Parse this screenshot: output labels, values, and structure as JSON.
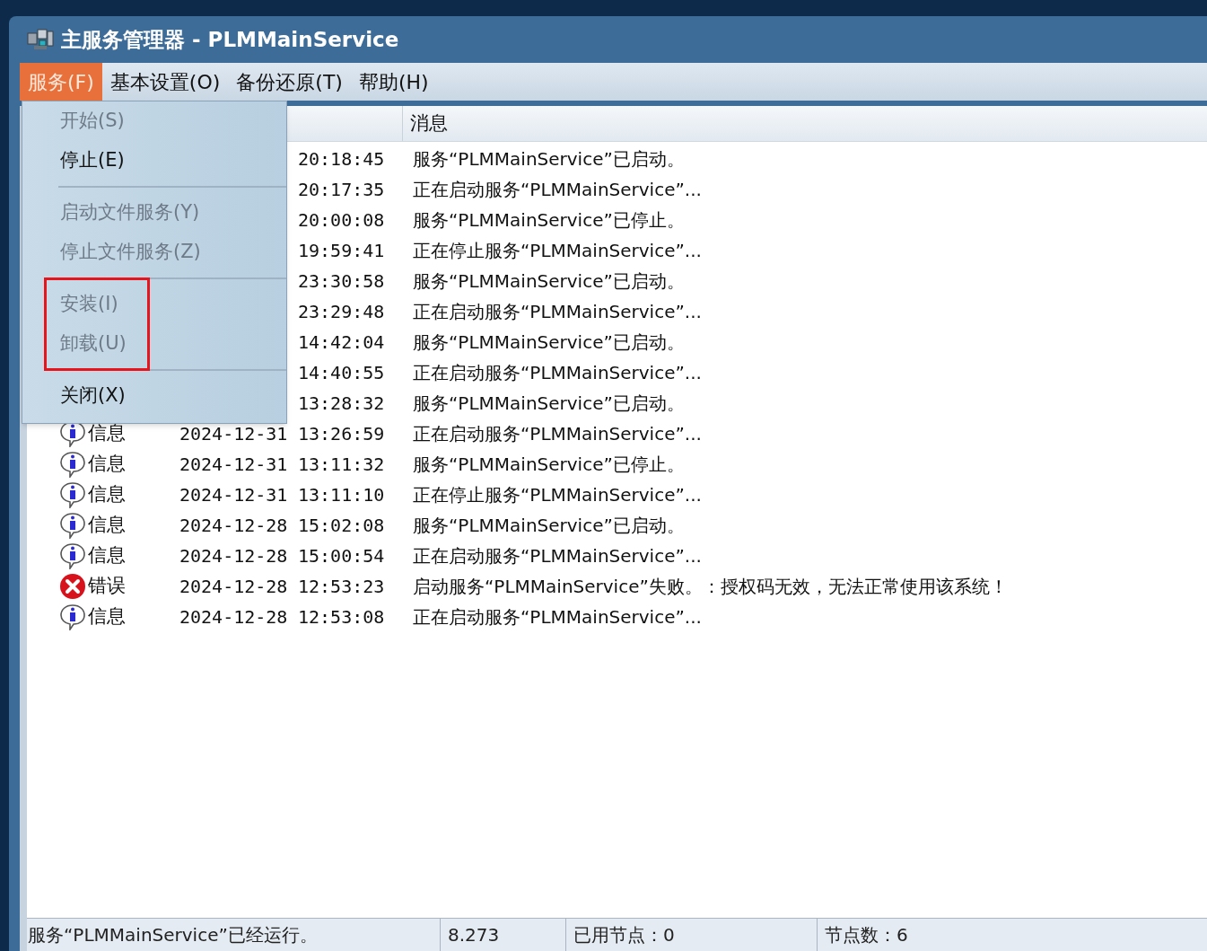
{
  "window": {
    "title": "主服务管理器 - PLMMainService"
  },
  "menu_bar": [
    {
      "label": "服务(F)",
      "selected": true
    },
    {
      "label": "基本设置(O)",
      "selected": false
    },
    {
      "label": "备份还原(T)",
      "selected": false
    },
    {
      "label": "帮助(H)",
      "selected": false
    }
  ],
  "dropdown": {
    "items": [
      {
        "kind": "item",
        "label": "开始(S)",
        "disabled": true,
        "highlighted": false
      },
      {
        "kind": "item",
        "label": "停止(E)",
        "disabled": false,
        "highlighted": false
      },
      {
        "kind": "separator"
      },
      {
        "kind": "item",
        "label": "启动文件服务(Y)",
        "disabled": true,
        "highlighted": false
      },
      {
        "kind": "item",
        "label": "停止文件服务(Z)",
        "disabled": true,
        "highlighted": false
      },
      {
        "kind": "separator"
      },
      {
        "kind": "item",
        "label": "安装(I)",
        "disabled": true,
        "highlighted": true
      },
      {
        "kind": "item",
        "label": "卸载(U)",
        "disabled": true,
        "highlighted": true
      },
      {
        "kind": "separator"
      },
      {
        "kind": "item",
        "label": "关闭(X)",
        "disabled": false,
        "highlighted": false
      }
    ]
  },
  "log": {
    "columns": [
      {
        "label": "消息"
      }
    ],
    "rows": [
      {
        "time": "20:18:45",
        "message": "服务“PLMMainService”已启动。"
      },
      {
        "time": "20:17:35",
        "message": "正在启动服务“PLMMainService”..."
      },
      {
        "time": "20:00:08",
        "message": "服务“PLMMainService”已停止。"
      },
      {
        "time": "19:59:41",
        "message": "正在停止服务“PLMMainService”..."
      },
      {
        "time": "23:30:58",
        "message": "服务“PLMMainService”已启动。"
      },
      {
        "time": "23:29:48",
        "message": "正在启动服务“PLMMainService”..."
      },
      {
        "time": "14:42:04",
        "message": "服务“PLMMainService”已启动。"
      },
      {
        "time": "14:40:55",
        "message": "正在启动服务“PLMMainService”..."
      },
      {
        "time": "13:28:32",
        "message": "服务“PLMMainService”已启动。"
      },
      {
        "kind": "info",
        "type": "信息",
        "date": "2024-12-31",
        "time": "13:26:59",
        "message": "正在启动服务“PLMMainService”..."
      },
      {
        "kind": "info",
        "type": "信息",
        "date": "2024-12-31",
        "time": "13:11:32",
        "message": "服务“PLMMainService”已停止。"
      },
      {
        "kind": "info",
        "type": "信息",
        "date": "2024-12-31",
        "time": "13:11:10",
        "message": "正在停止服务“PLMMainService”..."
      },
      {
        "kind": "info",
        "type": "信息",
        "date": "2024-12-28",
        "time": "15:02:08",
        "message": "服务“PLMMainService”已启动。"
      },
      {
        "kind": "info",
        "type": "信息",
        "date": "2024-12-28",
        "time": "15:00:54",
        "message": "正在启动服务“PLMMainService”..."
      },
      {
        "kind": "error",
        "type": "错误",
        "date": "2024-12-28",
        "time": "12:53:23",
        "message": "启动服务“PLMMainService”失败。：授权码无效，无法正常使用该系统！"
      },
      {
        "kind": "info",
        "type": "信息",
        "date": "2024-12-28",
        "time": "12:53:08",
        "message": "正在启动服务“PLMMainService”..."
      }
    ]
  },
  "status_bar": [
    "服务“PLMMainService”已经运行。",
    "8.273",
    "已用节点：0",
    "节点数：6"
  ]
}
